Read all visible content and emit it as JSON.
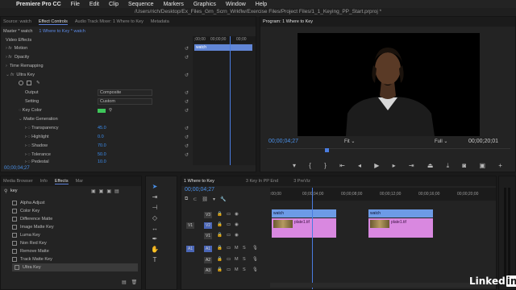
{
  "menubar": {
    "app": "Premiere Pro CC",
    "items": [
      "File",
      "Edit",
      "Clip",
      "Sequence",
      "Markers",
      "Graphics",
      "Window",
      "Help"
    ]
  },
  "titlebar": {
    "path": "/Users/rich/Desktop/Ex_Files_Grn_Scrn_Wrkflw/Exercise Files/Project Files/1_1_Keying_PP_Start.prproj *"
  },
  "effect_controls": {
    "tabs": [
      "Source: watch",
      "Effect Controls",
      "Audio Track Mixer: 1 Where to Key",
      "Metadata"
    ],
    "master": "Master * watch",
    "sequence_clip": "1 Where to Key * watch",
    "ruler_tc": [
      ";00;00",
      "00;00;00",
      "00;00"
    ],
    "clip_label": "watch",
    "section": "Video Effects",
    "rows": [
      {
        "label": "Motion",
        "type": "fx"
      },
      {
        "label": "Opacity",
        "type": "fx"
      },
      {
        "label": "Time Remapping",
        "type": "plain"
      },
      {
        "label": "Ultra Key",
        "type": "fx"
      },
      {
        "label": "Output",
        "value": "Composite",
        "type": "select"
      },
      {
        "label": "Setting",
        "value": "Custom",
        "type": "select"
      },
      {
        "label": "Key Color",
        "type": "color"
      },
      {
        "label": "Matte Generation",
        "type": "plain"
      },
      {
        "label": "Transparency",
        "value": "45.0",
        "type": "num"
      },
      {
        "label": "Highlight",
        "value": "0.0",
        "type": "num"
      },
      {
        "label": "Shadow",
        "value": "70.0",
        "type": "num"
      },
      {
        "label": "Tolerance",
        "value": "50.0",
        "type": "num"
      },
      {
        "label": "Pedestal",
        "value": "10.0",
        "type": "num"
      }
    ],
    "timecode": "00;00;04;27"
  },
  "program": {
    "title": "Program: 1 Where to Key",
    "timecode": "00;00;04;27",
    "fit": "Fit",
    "quality": "Full",
    "duration": "00;00;20;01"
  },
  "effects_browser": {
    "tabs": [
      "Media Browser",
      "Info",
      "Effects",
      "Mar"
    ],
    "search": "key",
    "items": [
      "Alpha Adjust",
      "Color Key",
      "Difference Matte",
      "Image Matte Key",
      "Luma Key",
      "Non Red Key",
      "Remove Matte",
      "Track Matte Key",
      "Ultra Key"
    ],
    "selected_index": 8
  },
  "timeline": {
    "tabs": [
      "1 Where to Key",
      "3 Key In PP End",
      "3 PreViz"
    ],
    "timecode": "00;00;04;27",
    "ruler": [
      ":00;00",
      "00;00;04;00",
      "00;00;08;00",
      "00;00;12;00",
      "00;00;16;00",
      "00;00;20;00"
    ],
    "tracks": [
      "V3",
      "V2",
      "V1",
      "A1",
      "A2",
      "A3"
    ],
    "clip_video": "watch",
    "clip_audio": "plate1.tif"
  },
  "logo": {
    "text": "Linked",
    "badge": "in"
  },
  "colors": {
    "accent": "#4a90e8",
    "clip_video": "#8fb6f0",
    "clip_audio": "#d988e0",
    "key_color": "#3ec65a"
  }
}
